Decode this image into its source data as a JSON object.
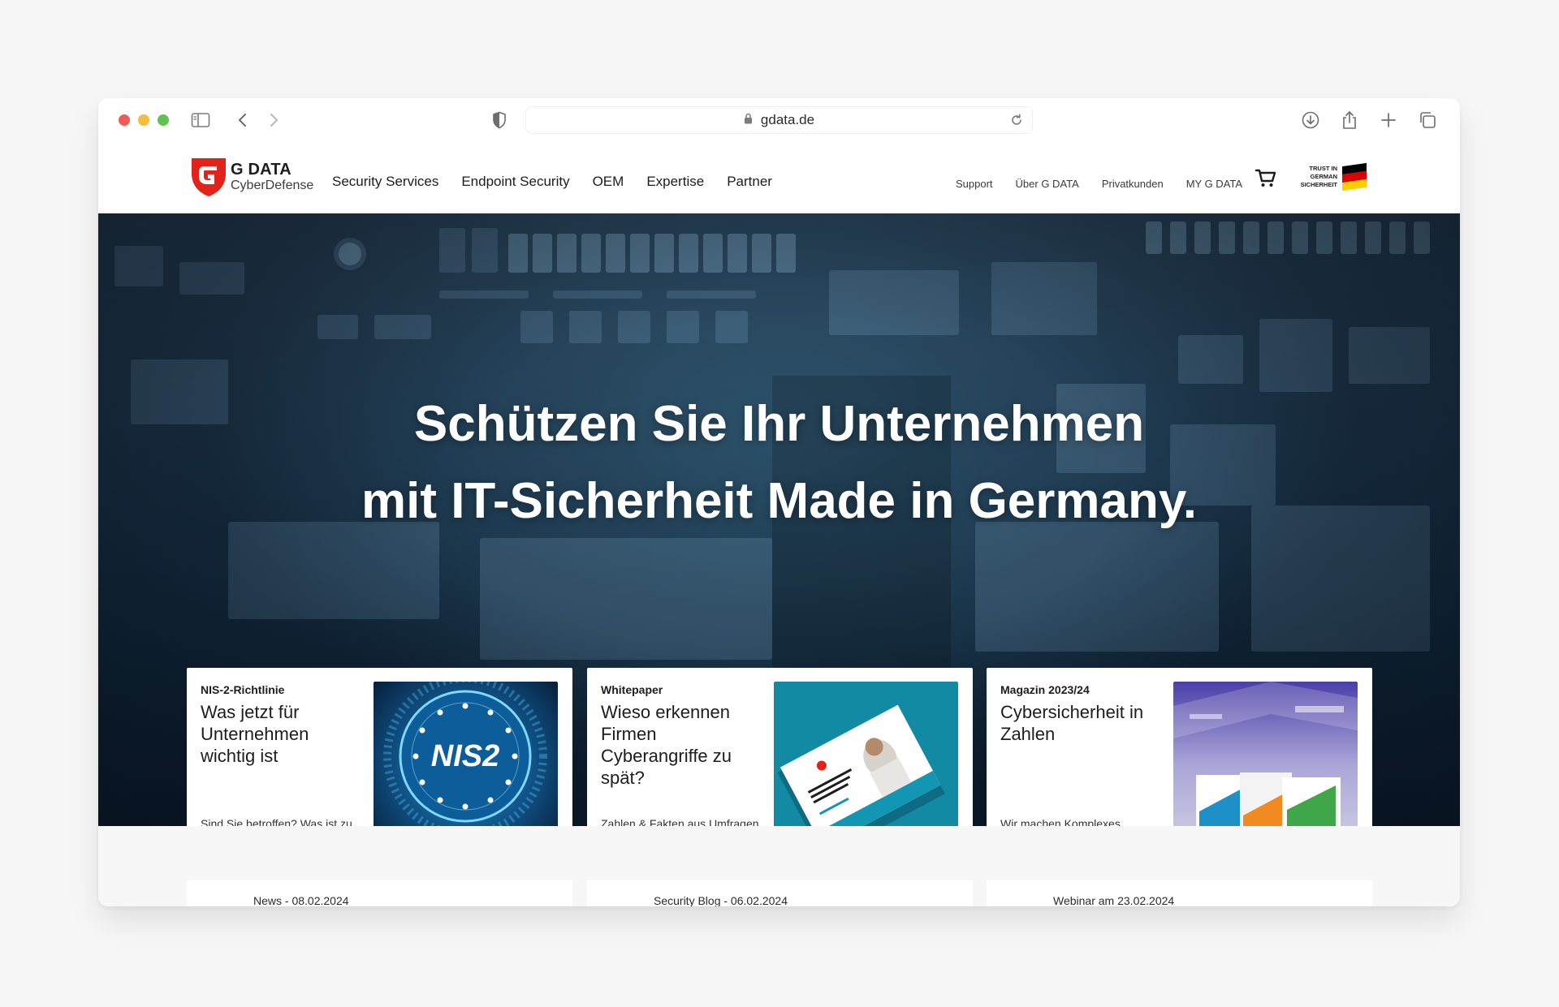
{
  "browser": {
    "url": "gdata.de"
  },
  "site": {
    "logo": {
      "brand": "G DATA",
      "sub": "CyberDefense"
    },
    "main_nav": [
      "Security Services",
      "Endpoint Security",
      "OEM",
      "Expertise",
      "Partner"
    ],
    "util_nav": [
      "Support",
      "Über G DATA",
      "Privatkunden",
      "MY G DATA"
    ],
    "trust_badge": [
      "TRUST IN",
      "GERMAN",
      "SICHERHEIT"
    ],
    "flag_colors": [
      "#000000",
      "#dd0000",
      "#ffce00"
    ]
  },
  "hero": {
    "line1": "Schützen Sie Ihr Unternehmen",
    "line2_regular": "mit IT-Sicherheit",
    "line2_bold": "Made in Germany."
  },
  "cards": [
    {
      "kicker": "NIS-2-Richtlinie",
      "title": "Was jetzt für Unternehmen wichtig ist",
      "desc": "Sind Sie betroffen? Was ist zu tun? Die EU-Richtlinie einfach erklärt.",
      "image_label": "NIS2"
    },
    {
      "kicker": "Whitepaper",
      "title": "Wieso erkennen Firmen Cyberangriffe zu spät?",
      "desc": "Zahlen & Fakten aus Umfragen in Unternehmen. Jetzt Paper lesen."
    },
    {
      "kicker": "Magazin 2023/24",
      "title": "Cybersicherheit in Zahlen",
      "desc": "Wir machen Komplexes verständlich. Jetzt kostenfrei erhalten."
    }
  ],
  "news": [
    "News - 08.02.2024",
    "Security Blog - 06.02.2024",
    "Webinar am 23.02.2024"
  ],
  "colors": {
    "brand_red": "#e2231a",
    "hero_dark": "#12283b"
  }
}
